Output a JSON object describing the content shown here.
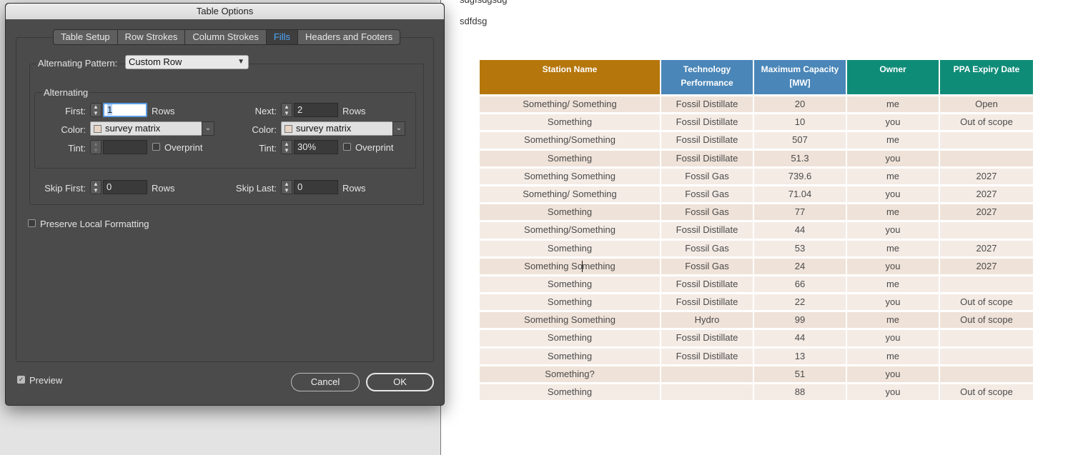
{
  "document": {
    "paragraph_1": "sdgfsdgsdg",
    "paragraph_2": "sdfdsg",
    "table": {
      "headers": [
        "Station Name",
        "Technology Performance",
        "Maximum Capacity [MW]",
        "Owner",
        "PPA Expiry Date"
      ],
      "header_colors": [
        "#b5760b",
        "#4a86b8",
        "#4a86b8",
        "#0f8c78",
        "#0f8c78"
      ],
      "rows": [
        [
          "Something/ Something",
          "Fossil Distillate",
          "20",
          "me",
          "Open"
        ],
        [
          "Something",
          "Fossil Distillate",
          "10",
          "you",
          "Out of scope"
        ],
        [
          "Something/Something",
          "Fossil Distillate",
          "507",
          "me",
          ""
        ],
        [
          "Something",
          "Fossil Distillate",
          "51.3",
          "you",
          ""
        ],
        [
          "Something Something",
          "Fossil Gas",
          "739.6",
          "me",
          "2027"
        ],
        [
          "Something/ Something",
          "Fossil Gas",
          "71.04",
          "you",
          "2027"
        ],
        [
          "Something",
          "Fossil Gas",
          "77",
          "me",
          "2027"
        ],
        [
          "Something/Something",
          "Fossil Distillate",
          "44",
          "you",
          ""
        ],
        [
          "Something",
          "Fossil Gas",
          "53",
          "me",
          "2027"
        ],
        [
          "Something Something",
          "Fossil Gas",
          "24",
          "you",
          "2027"
        ],
        [
          "Something",
          "Fossil Distillate",
          "66",
          "me",
          ""
        ],
        [
          "Something",
          "Fossil Distillate",
          "22",
          "you",
          "Out of scope"
        ],
        [
          "Something Something",
          "Hydro",
          "99",
          "me",
          "Out of scope"
        ],
        [
          "Something",
          "Fossil Distillate",
          "44",
          "you",
          ""
        ],
        [
          "Something",
          "Fossil Distillate",
          "13",
          "me",
          ""
        ],
        [
          "Something?",
          "",
          "51",
          "you",
          ""
        ],
        [
          "Something",
          "",
          "88",
          "you",
          "Out of scope"
        ]
      ]
    }
  },
  "dialog": {
    "title": "Table Options",
    "tabs": [
      "Table Setup",
      "Row Strokes",
      "Column Strokes",
      "Fills",
      "Headers and Footers"
    ],
    "active_tab": "Fills",
    "alternating_pattern_label": "Alternating Pattern:",
    "alternating_pattern_value": "Custom Row",
    "alternating_group_label": "Alternating",
    "first_label": "First:",
    "first_value": "1",
    "first_unit": "Rows",
    "next_label": "Next:",
    "next_value": "2",
    "next_unit": "Rows",
    "color_label": "Color:",
    "first_color": "survey matrix",
    "next_color": "survey matrix",
    "tint_label": "Tint:",
    "first_tint": "",
    "next_tint": "30%",
    "overprint_label": "Overprint",
    "skip_first_label": "Skip First:",
    "skip_first_value": "0",
    "skip_first_unit": "Rows",
    "skip_last_label": "Skip Last:",
    "skip_last_value": "0",
    "skip_last_unit": "Rows",
    "preserve_label": "Preserve Local Formatting",
    "preview_label": "Preview",
    "cancel_label": "Cancel",
    "ok_label": "OK"
  }
}
